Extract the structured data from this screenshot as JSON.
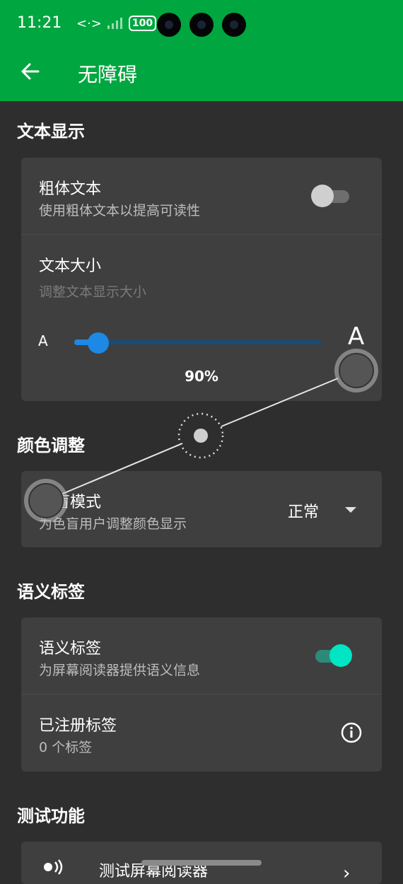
{
  "status": {
    "time": "11:21",
    "battery": "100"
  },
  "appbar": {
    "title": "无障碍"
  },
  "sections": {
    "text_display": "文本显示",
    "color_adjust": "颜色调整",
    "semantic_labels": "语义标签",
    "test_features": "测试功能"
  },
  "bold_text": {
    "title": "粗体文本",
    "subtitle": "使用粗体文本以提高可读性",
    "enabled": false
  },
  "text_size": {
    "title": "文本大小",
    "subtitle": "调整文本显示大小",
    "small_label": "A",
    "large_label": "A",
    "value_text": "90%",
    "level_fraction": 0.06
  },
  "color_blind": {
    "title": "色盲模式",
    "subtitle": "为色盲用户调整颜色显示",
    "selected": "正常"
  },
  "semantic": {
    "title": "语义标签",
    "subtitle": "为屏幕阅读器提供语义信息",
    "enabled": true
  },
  "registered": {
    "title": "已注册标签",
    "subtitle": "0 个标签"
  },
  "test_reader": {
    "title": "测试屏幕阅读器"
  },
  "colors": {
    "appbar": "#00a63f",
    "accent": "#00e5c4",
    "slider": "#1e88e5"
  }
}
